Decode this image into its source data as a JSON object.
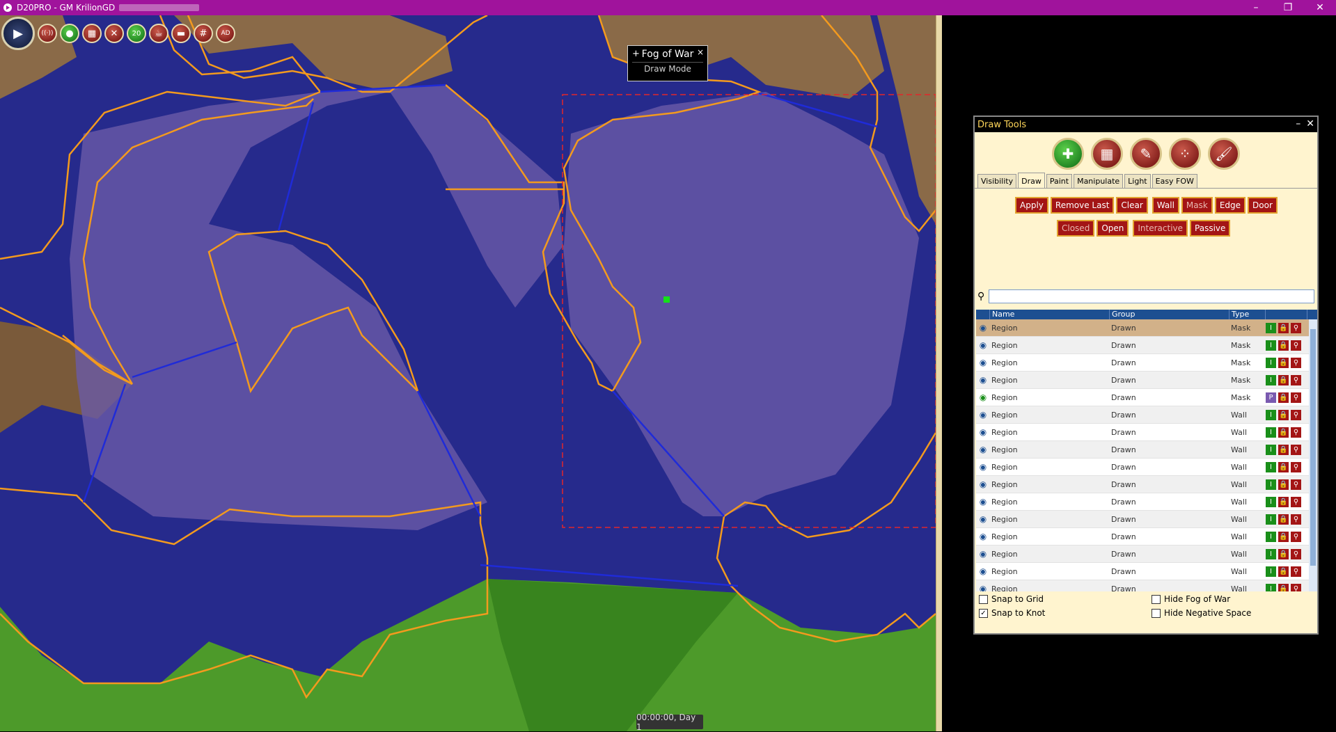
{
  "window": {
    "title": "D20PRO - GM KrilionGD",
    "controls": [
      "–",
      "❐",
      "✕"
    ]
  },
  "toolbar": {
    "main_icon": "▶",
    "buttons": [
      {
        "icon": "wifi-icon",
        "glyph": "((·))"
      },
      {
        "icon": "circle-icon",
        "glyph": "●"
      },
      {
        "icon": "tiles-icon",
        "glyph": "▦"
      },
      {
        "icon": "swords-icon",
        "glyph": "✕"
      },
      {
        "icon": "d20-icon",
        "glyph": "20"
      },
      {
        "icon": "mug-icon",
        "glyph": "☕"
      },
      {
        "icon": "ruler-icon",
        "glyph": "▬"
      },
      {
        "icon": "grid-icon",
        "glyph": "#"
      },
      {
        "icon": "ad-icon",
        "glyph": "AD"
      }
    ]
  },
  "fow_label": {
    "plus": "+",
    "title": "Fog of War",
    "subtitle": "Draw Mode",
    "close": "×"
  },
  "clock": {
    "text": "00:00:00, Day 1"
  },
  "panel": {
    "title": "Draw Tools",
    "minimize": "–",
    "close": "✕",
    "tool_icons": [
      {
        "name": "add-region-icon",
        "glyph": "✚"
      },
      {
        "name": "grid-region-icon",
        "glyph": "▦"
      },
      {
        "name": "edit-region-icon",
        "glyph": "✎"
      },
      {
        "name": "dots-region-icon",
        "glyph": "⁘"
      },
      {
        "name": "brush-icon",
        "glyph": "🖌"
      }
    ],
    "tabs": [
      "Visibility",
      "Draw",
      "Paint",
      "Manipulate",
      "Light",
      "Easy FOW"
    ],
    "active_tab": "Draw",
    "buttons_row1": {
      "apply": "Apply",
      "remove_last": "Remove Last",
      "clear": "Clear",
      "wall": "Wall",
      "mask": "Mask",
      "edge": "Edge",
      "door": "Door"
    },
    "buttons_row2": {
      "closed": "Closed",
      "open": "Open",
      "interactive": "Interactive",
      "passive": "Passive"
    },
    "search": {
      "value": "",
      "placeholder": ""
    },
    "grid": {
      "headers": [
        "Name",
        "Group",
        "Type"
      ],
      "rows": [
        {
          "name": "Region",
          "group": "Drawn",
          "type": "Mask",
          "sel": true,
          "badge": "I"
        },
        {
          "name": "Region",
          "group": "Drawn",
          "type": "Mask",
          "badge": "I"
        },
        {
          "name": "Region",
          "group": "Drawn",
          "type": "Mask",
          "badge": "I"
        },
        {
          "name": "Region",
          "group": "Drawn",
          "type": "Mask",
          "badge": "I"
        },
        {
          "name": "Region",
          "group": "Drawn",
          "type": "Mask",
          "badge": "P",
          "eye_green": true
        },
        {
          "name": "Region",
          "group": "Drawn",
          "type": "Wall",
          "badge": "I"
        },
        {
          "name": "Region",
          "group": "Drawn",
          "type": "Wall",
          "badge": "I"
        },
        {
          "name": "Region",
          "group": "Drawn",
          "type": "Wall",
          "badge": "I"
        },
        {
          "name": "Region",
          "group": "Drawn",
          "type": "Wall",
          "badge": "I"
        },
        {
          "name": "Region",
          "group": "Drawn",
          "type": "Wall",
          "badge": "I"
        },
        {
          "name": "Region",
          "group": "Drawn",
          "type": "Wall",
          "badge": "I"
        },
        {
          "name": "Region",
          "group": "Drawn",
          "type": "Wall",
          "badge": "I"
        },
        {
          "name": "Region",
          "group": "Drawn",
          "type": "Wall",
          "badge": "I"
        },
        {
          "name": "Region",
          "group": "Drawn",
          "type": "Wall",
          "badge": "I"
        },
        {
          "name": "Region",
          "group": "Drawn",
          "type": "Wall",
          "badge": "I"
        },
        {
          "name": "Region",
          "group": "Drawn",
          "type": "Wall",
          "badge": "I"
        }
      ]
    },
    "options": {
      "snap_grid": {
        "label": "Snap to Grid",
        "checked": false
      },
      "snap_knot": {
        "label": "Snap to Knot",
        "checked": true
      },
      "hide_fow": {
        "label": "Hide Fog of War",
        "checked": false
      },
      "hide_neg": {
        "label": "Hide Negative Space",
        "checked": false
      }
    }
  }
}
